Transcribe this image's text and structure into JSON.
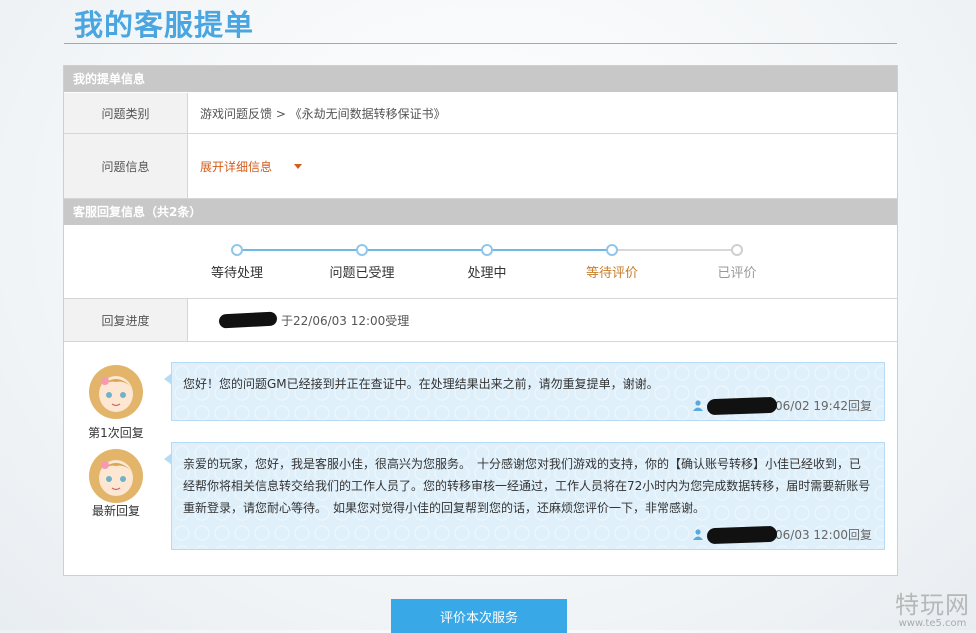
{
  "page": {
    "title": "我的客服提单"
  },
  "ticket_info": {
    "header": "我的提单信息",
    "category_label": "问题类别",
    "category_value": "游戏问题反馈 > 《永劫无间数据转移保证书》",
    "info_label": "问题信息",
    "expand_text": "展开详细信息"
  },
  "reply_info": {
    "header": "客服回复信息（共2条）",
    "steps": [
      {
        "label": "等待处理",
        "state": "done"
      },
      {
        "label": "问题已受理",
        "state": "done"
      },
      {
        "label": "处理中",
        "state": "done"
      },
      {
        "label": "等待评价",
        "state": "current"
      },
      {
        "label": "已评价",
        "state": "pending"
      }
    ],
    "progress_label": "回复进度",
    "progress_value": "于22/06/03 12:00受理"
  },
  "replies": [
    {
      "label": "第1次回复",
      "text": "您好！您的问题GM已经接到并正在查证中。在处理结果出来之前，请勿重复提单，谢谢。",
      "meta": "/06/02 19:42回复"
    },
    {
      "label": "最新回复",
      "text": "亲爱的玩家，您好，我是客服小佳，很高兴为您服务。　十分感谢您对我们游戏的支持，你的【确认账号转移】小佳已经收到，已经帮你将相关信息转交给我们的工作人员了。您的转移审核一经通过，工作人员将在72小时内为您完成数据转移，届时需要新账号重新登录，请您耐心等待。　如果您对觉得小佳的回复帮到您的话，还麻烦您评价一下，非常感谢。",
      "meta": "/06/03 12:00回复"
    }
  ],
  "rate_button": "评价本次服务",
  "watermark": {
    "name": "特玩网",
    "url": "www.te5.com"
  },
  "colors": {
    "accent": "#4aa6e0",
    "button": "#39a8e6",
    "expand": "#d25d1c",
    "step_current": "#c87d2a"
  }
}
